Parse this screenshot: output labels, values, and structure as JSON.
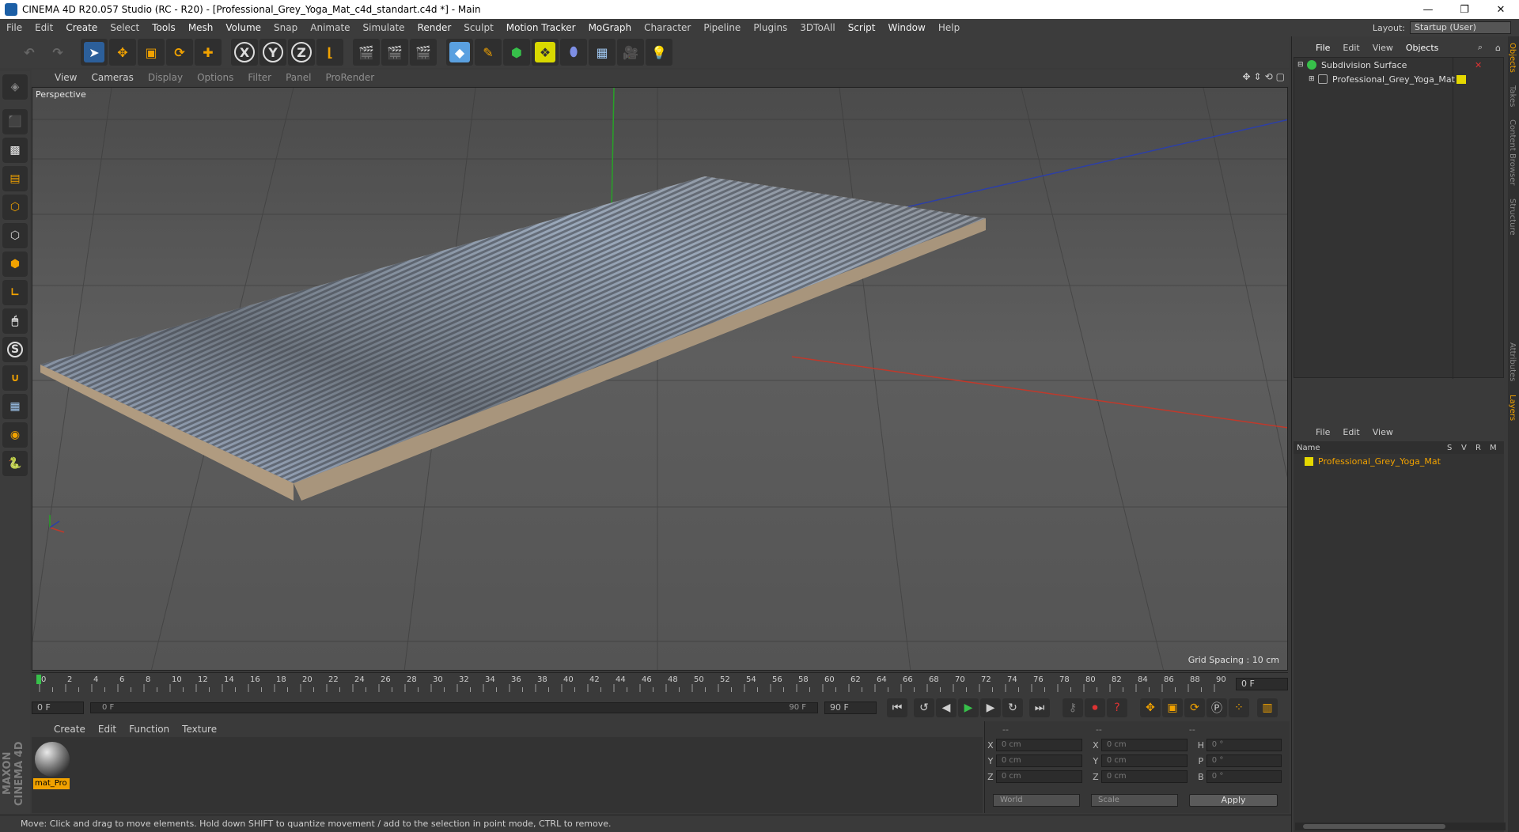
{
  "window": {
    "title": "CINEMA 4D R20.057 Studio (RC - R20) - [Professional_Grey_Yoga_Mat_c4d_standart.c4d *] - Main",
    "minimize": "—",
    "restore": "❐",
    "close": "✕"
  },
  "menu": [
    "File",
    "Edit",
    "Create",
    "Select",
    "Tools",
    "Mesh",
    "Volume",
    "Snap",
    "Animate",
    "Simulate",
    "Render",
    "Sculpt",
    "Motion Tracker",
    "MoGraph",
    "Character",
    "Pipeline",
    "Plugins",
    "3DToAll",
    "Script",
    "Window",
    "Help"
  ],
  "layout": {
    "label": "Layout:",
    "value": "Startup (User)"
  },
  "viewport": {
    "menu": [
      "View",
      "Cameras",
      "Display",
      "Options",
      "Filter",
      "Panel",
      "ProRender"
    ],
    "label": "Perspective",
    "grid_spacing": "Grid Spacing : 10 cm"
  },
  "timeline": {
    "ticks": [
      "0",
      "2",
      "4",
      "6",
      "8",
      "10",
      "12",
      "14",
      "16",
      "18",
      "20",
      "22",
      "24",
      "26",
      "28",
      "30",
      "32",
      "34",
      "36",
      "38",
      "40",
      "42",
      "44",
      "46",
      "48",
      "50",
      "52",
      "54",
      "56",
      "58",
      "60",
      "62",
      "64",
      "66",
      "68",
      "70",
      "72",
      "74",
      "76",
      "78",
      "80",
      "82",
      "84",
      "86",
      "88",
      "90"
    ],
    "current_frame": "0 F",
    "start_field": "0 F",
    "slider_left": "0 F",
    "slider_right": "90 F",
    "end_field": "90 F"
  },
  "material": {
    "menu": [
      "Create",
      "Edit",
      "Function",
      "Texture"
    ],
    "name": "mat_Pro"
  },
  "coords": {
    "headers": [
      "--",
      "--",
      "--"
    ],
    "rows": [
      {
        "a": "X",
        "av": "0 cm",
        "b": "X",
        "bv": "0 cm",
        "c": "H",
        "cv": "0 °"
      },
      {
        "a": "Y",
        "av": "0 cm",
        "b": "Y",
        "bv": "0 cm",
        "c": "P",
        "cv": "0 °"
      },
      {
        "a": "Z",
        "av": "0 cm",
        "b": "Z",
        "bv": "0 cm",
        "c": "B",
        "cv": "0 °"
      }
    ],
    "world": "World",
    "scale": "Scale",
    "apply": "Apply"
  },
  "status": "Move: Click and drag to move elements. Hold down SHIFT to quantize movement / add to the selection in point mode, CTRL to remove.",
  "brand": "MAXON CINEMA 4D",
  "objects": {
    "menu": [
      "File",
      "Edit",
      "View",
      "Objects"
    ],
    "items": [
      "Subdivision Surface",
      "Professional_Grey_Yoga_Mat"
    ]
  },
  "layers": {
    "menu": [
      "File",
      "Edit",
      "View"
    ],
    "cols": [
      "Name",
      "S",
      "V",
      "R",
      "M"
    ],
    "item": "Professional_Grey_Yoga_Mat"
  },
  "side_tabs": [
    "Objects",
    "Takes",
    "Content Browser",
    "Structure"
  ],
  "side_tabs_lower": [
    "Attributes",
    "Layers"
  ],
  "colors": {
    "accent": "#f1a200",
    "axis_x": "#c0392b",
    "axis_y": "#27a227",
    "axis_z": "#2c3fa8",
    "layer": "#e5d800"
  }
}
